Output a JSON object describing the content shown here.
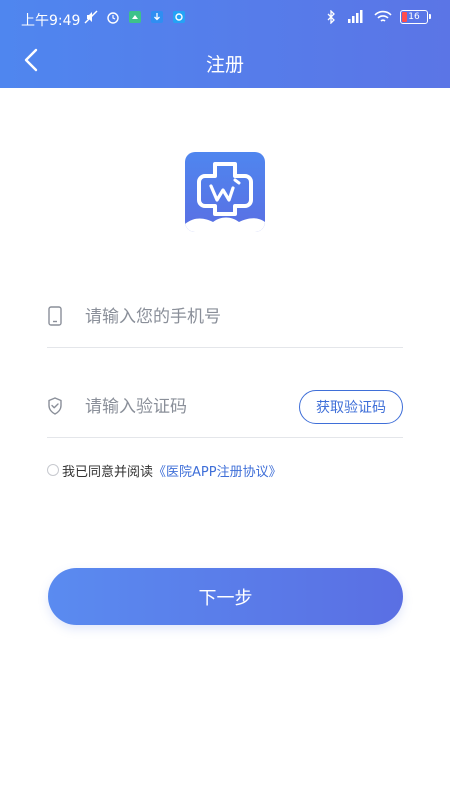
{
  "status_bar": {
    "time": "上午9:49",
    "battery": "16"
  },
  "nav": {
    "title": "注册"
  },
  "form": {
    "phone_placeholder": "请输入您的手机号",
    "code_placeholder": "请输入验证码",
    "get_code_label": "获取验证码"
  },
  "agreement": {
    "text": "我已同意并阅读",
    "link": "《医院APP注册协议》"
  },
  "next_label": "下一步",
  "colors": {
    "header_start": "#4f86ef",
    "header_end": "#5b75e6",
    "accent": "#3f6fd8",
    "button_start": "#5a8bf0",
    "button_end": "#5a6fe3"
  },
  "icons": {
    "back": "chevron-left-icon",
    "phone": "mobile-phone-icon",
    "code": "shield-check-icon"
  }
}
